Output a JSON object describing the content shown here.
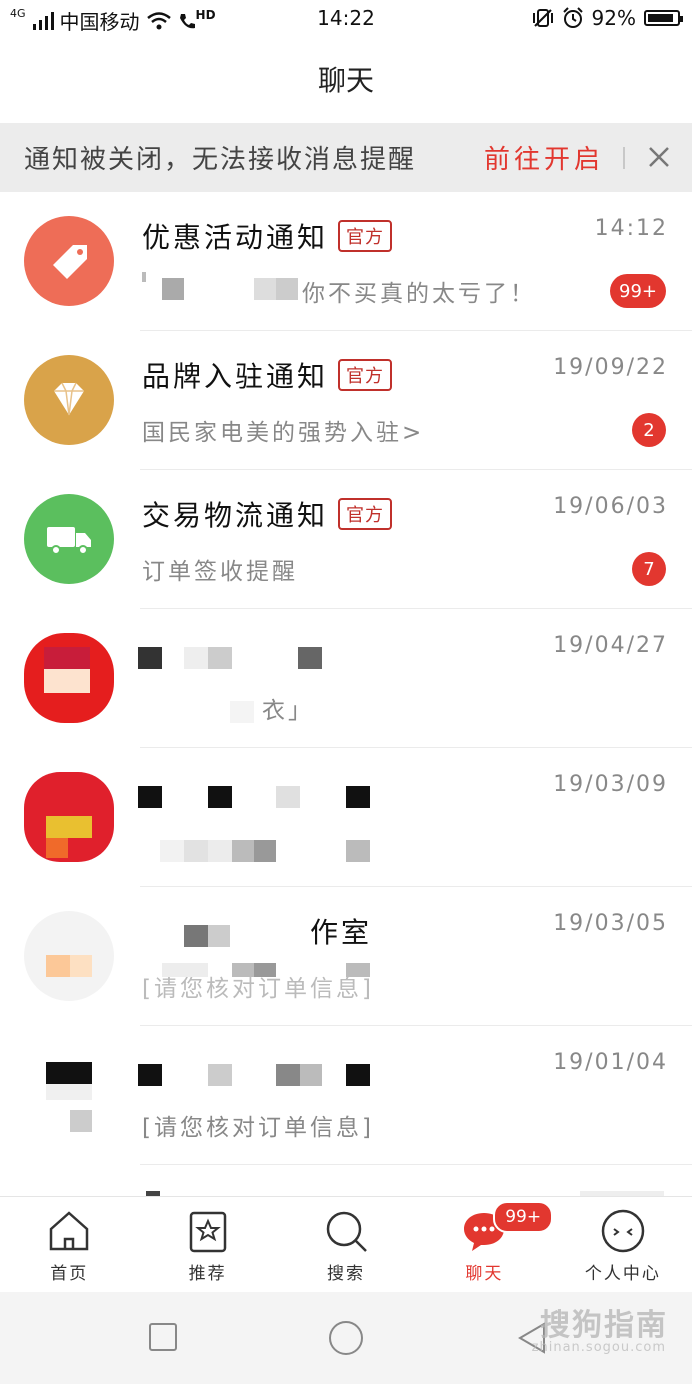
{
  "status_bar": {
    "network": "4G",
    "carrier": "中国移动",
    "hd": "HD",
    "time": "14:22",
    "battery": "92%"
  },
  "header": {
    "title": "聊天"
  },
  "notice": {
    "text": "通知被关闭，无法接收消息提醒",
    "action": "前往开启"
  },
  "conversations": [
    {
      "title": "优惠活动通知",
      "tag": "官方",
      "date": "14:12",
      "preview": "你不买真的太亏了！",
      "badge": "99+",
      "icon": "price-tag-icon",
      "color": "#ee6d57"
    },
    {
      "title": "品牌入驻通知",
      "tag": "官方",
      "date": "19/09/22",
      "preview": "国民家电美的强势入驻>",
      "badge": "2",
      "icon": "diamond-icon",
      "color": "#d9a34a"
    },
    {
      "title": "交易物流通知",
      "tag": "官方",
      "date": "19/06/03",
      "preview": "订单签收提醒",
      "badge": "7",
      "icon": "truck-icon",
      "color": "#5bbf5e"
    },
    {
      "title": "",
      "date": "19/04/27",
      "preview": "衣」"
    },
    {
      "title": "",
      "date": "19/03/09",
      "preview": ""
    },
    {
      "title": "作室",
      "date": "19/03/05",
      "preview": "[请您核对订单信息]"
    },
    {
      "title": "",
      "date": "19/01/04",
      "preview": "[请您核对订单信息]"
    }
  ],
  "tabbar": {
    "tabs": [
      {
        "label": "首页",
        "icon": "home-icon"
      },
      {
        "label": "推荐",
        "icon": "star-icon"
      },
      {
        "label": "搜索",
        "icon": "search-icon"
      },
      {
        "label": "聊天",
        "icon": "chat-icon",
        "active": true,
        "badge": "99+"
      },
      {
        "label": "个人中心",
        "icon": "profile-face-icon"
      }
    ]
  },
  "watermark": {
    "text": "搜狗指南",
    "sub": "zhinan.sogou.com"
  },
  "colors": {
    "accent": "#e2372f",
    "notice_bg": "#ececec"
  }
}
